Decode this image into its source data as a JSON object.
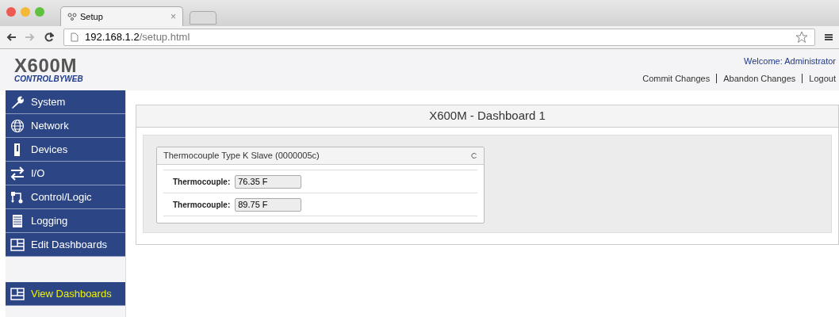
{
  "browser": {
    "tab_title": "Setup",
    "tab_close": "×",
    "url_host": "192.168.1.2",
    "url_path": "/setup.html"
  },
  "header": {
    "logo_model": "X600M",
    "logo_brand": "CONTROLBYWEB",
    "welcome": "Welcome: Administrator",
    "links": [
      "Commit Changes",
      "Abandon Changes",
      "Logout"
    ]
  },
  "sidebar": {
    "items": [
      {
        "label": "System",
        "kind": "wrench",
        "selected": false
      },
      {
        "label": "Network",
        "kind": "globe",
        "selected": false
      },
      {
        "label": "Devices",
        "kind": "device",
        "selected": false
      },
      {
        "label": "I/O",
        "kind": "arrows",
        "selected": false
      },
      {
        "label": "Control/Logic",
        "kind": "logic",
        "selected": false
      },
      {
        "label": "Logging",
        "kind": "log",
        "selected": false
      },
      {
        "label": "Edit Dashboards",
        "kind": "dashboard",
        "selected": false
      }
    ],
    "bottom_items": [
      {
        "label": "View Dashboards",
        "kind": "dashboard",
        "selected": true
      }
    ]
  },
  "dashboard": {
    "title": "X600M - Dashboard 1",
    "widget": {
      "title": "Thermocouple Type K Slave (0000005c)",
      "rows": [
        {
          "label": "Thermocouple:",
          "value": "76.35 F"
        },
        {
          "label": "Thermocouple:",
          "value": "89.75 F"
        }
      ]
    }
  }
}
